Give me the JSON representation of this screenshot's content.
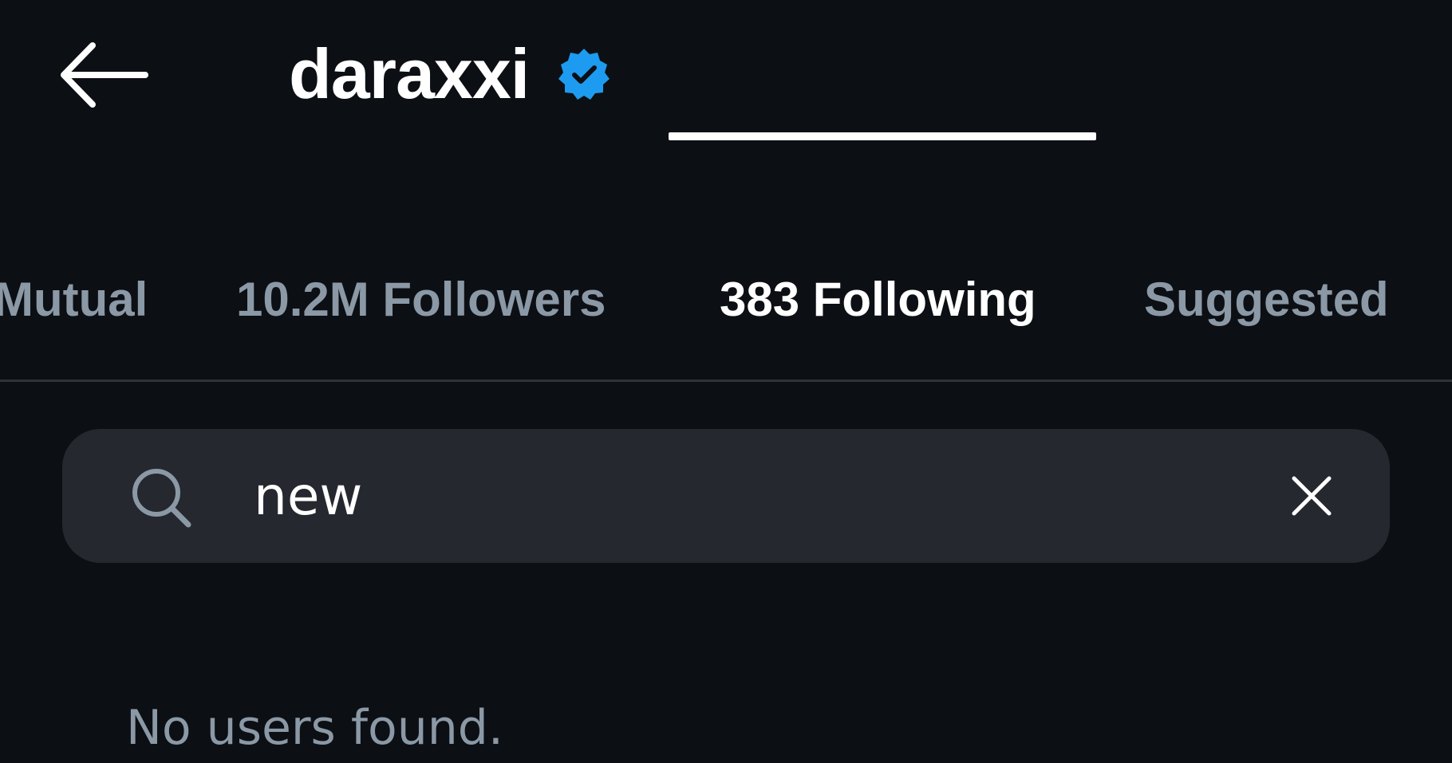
{
  "header": {
    "title": "daraxxi",
    "back_icon": "arrow-left-icon",
    "verified_icon": "verified-badge-icon",
    "verified_color": "#1d9bf0"
  },
  "tabs": [
    {
      "label": "Mutual",
      "active": false
    },
    {
      "label": "10.2M Followers",
      "active": false
    },
    {
      "label": "383 Following",
      "active": true
    },
    {
      "label": "Suggested",
      "active": false
    }
  ],
  "search": {
    "value": "new",
    "search_icon": "search-icon",
    "clear_icon": "close-icon"
  },
  "empty_state": {
    "message": "No users found."
  },
  "colors": {
    "background": "#0c0f14",
    "search_background": "#25282e",
    "muted_text": "#8b98a5",
    "accent": "#1d9bf0"
  }
}
